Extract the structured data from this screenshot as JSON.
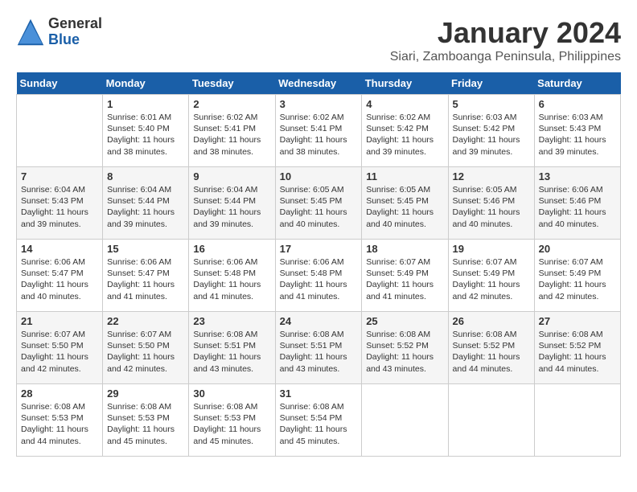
{
  "header": {
    "logo_general": "General",
    "logo_blue": "Blue",
    "calendar_title": "January 2024",
    "calendar_subtitle": "Siari, Zamboanga Peninsula, Philippines"
  },
  "weekdays": [
    "Sunday",
    "Monday",
    "Tuesday",
    "Wednesday",
    "Thursday",
    "Friday",
    "Saturday"
  ],
  "weeks": [
    [
      {
        "day": "",
        "info": ""
      },
      {
        "day": "1",
        "info": "Sunrise: 6:01 AM\nSunset: 5:40 PM\nDaylight: 11 hours\nand 38 minutes."
      },
      {
        "day": "2",
        "info": "Sunrise: 6:02 AM\nSunset: 5:41 PM\nDaylight: 11 hours\nand 38 minutes."
      },
      {
        "day": "3",
        "info": "Sunrise: 6:02 AM\nSunset: 5:41 PM\nDaylight: 11 hours\nand 38 minutes."
      },
      {
        "day": "4",
        "info": "Sunrise: 6:02 AM\nSunset: 5:42 PM\nDaylight: 11 hours\nand 39 minutes."
      },
      {
        "day": "5",
        "info": "Sunrise: 6:03 AM\nSunset: 5:42 PM\nDaylight: 11 hours\nand 39 minutes."
      },
      {
        "day": "6",
        "info": "Sunrise: 6:03 AM\nSunset: 5:43 PM\nDaylight: 11 hours\nand 39 minutes."
      }
    ],
    [
      {
        "day": "7",
        "info": "Sunrise: 6:04 AM\nSunset: 5:43 PM\nDaylight: 11 hours\nand 39 minutes."
      },
      {
        "day": "8",
        "info": "Sunrise: 6:04 AM\nSunset: 5:44 PM\nDaylight: 11 hours\nand 39 minutes."
      },
      {
        "day": "9",
        "info": "Sunrise: 6:04 AM\nSunset: 5:44 PM\nDaylight: 11 hours\nand 39 minutes."
      },
      {
        "day": "10",
        "info": "Sunrise: 6:05 AM\nSunset: 5:45 PM\nDaylight: 11 hours\nand 40 minutes."
      },
      {
        "day": "11",
        "info": "Sunrise: 6:05 AM\nSunset: 5:45 PM\nDaylight: 11 hours\nand 40 minutes."
      },
      {
        "day": "12",
        "info": "Sunrise: 6:05 AM\nSunset: 5:46 PM\nDaylight: 11 hours\nand 40 minutes."
      },
      {
        "day": "13",
        "info": "Sunrise: 6:06 AM\nSunset: 5:46 PM\nDaylight: 11 hours\nand 40 minutes."
      }
    ],
    [
      {
        "day": "14",
        "info": "Sunrise: 6:06 AM\nSunset: 5:47 PM\nDaylight: 11 hours\nand 40 minutes."
      },
      {
        "day": "15",
        "info": "Sunrise: 6:06 AM\nSunset: 5:47 PM\nDaylight: 11 hours\nand 41 minutes."
      },
      {
        "day": "16",
        "info": "Sunrise: 6:06 AM\nSunset: 5:48 PM\nDaylight: 11 hours\nand 41 minutes."
      },
      {
        "day": "17",
        "info": "Sunrise: 6:06 AM\nSunset: 5:48 PM\nDaylight: 11 hours\nand 41 minutes."
      },
      {
        "day": "18",
        "info": "Sunrise: 6:07 AM\nSunset: 5:49 PM\nDaylight: 11 hours\nand 41 minutes."
      },
      {
        "day": "19",
        "info": "Sunrise: 6:07 AM\nSunset: 5:49 PM\nDaylight: 11 hours\nand 42 minutes."
      },
      {
        "day": "20",
        "info": "Sunrise: 6:07 AM\nSunset: 5:49 PM\nDaylight: 11 hours\nand 42 minutes."
      }
    ],
    [
      {
        "day": "21",
        "info": "Sunrise: 6:07 AM\nSunset: 5:50 PM\nDaylight: 11 hours\nand 42 minutes."
      },
      {
        "day": "22",
        "info": "Sunrise: 6:07 AM\nSunset: 5:50 PM\nDaylight: 11 hours\nand 42 minutes."
      },
      {
        "day": "23",
        "info": "Sunrise: 6:08 AM\nSunset: 5:51 PM\nDaylight: 11 hours\nand 43 minutes."
      },
      {
        "day": "24",
        "info": "Sunrise: 6:08 AM\nSunset: 5:51 PM\nDaylight: 11 hours\nand 43 minutes."
      },
      {
        "day": "25",
        "info": "Sunrise: 6:08 AM\nSunset: 5:52 PM\nDaylight: 11 hours\nand 43 minutes."
      },
      {
        "day": "26",
        "info": "Sunrise: 6:08 AM\nSunset: 5:52 PM\nDaylight: 11 hours\nand 44 minutes."
      },
      {
        "day": "27",
        "info": "Sunrise: 6:08 AM\nSunset: 5:52 PM\nDaylight: 11 hours\nand 44 minutes."
      }
    ],
    [
      {
        "day": "28",
        "info": "Sunrise: 6:08 AM\nSunset: 5:53 PM\nDaylight: 11 hours\nand 44 minutes."
      },
      {
        "day": "29",
        "info": "Sunrise: 6:08 AM\nSunset: 5:53 PM\nDaylight: 11 hours\nand 45 minutes."
      },
      {
        "day": "30",
        "info": "Sunrise: 6:08 AM\nSunset: 5:53 PM\nDaylight: 11 hours\nand 45 minutes."
      },
      {
        "day": "31",
        "info": "Sunrise: 6:08 AM\nSunset: 5:54 PM\nDaylight: 11 hours\nand 45 minutes."
      },
      {
        "day": "",
        "info": ""
      },
      {
        "day": "",
        "info": ""
      },
      {
        "day": "",
        "info": ""
      }
    ]
  ]
}
